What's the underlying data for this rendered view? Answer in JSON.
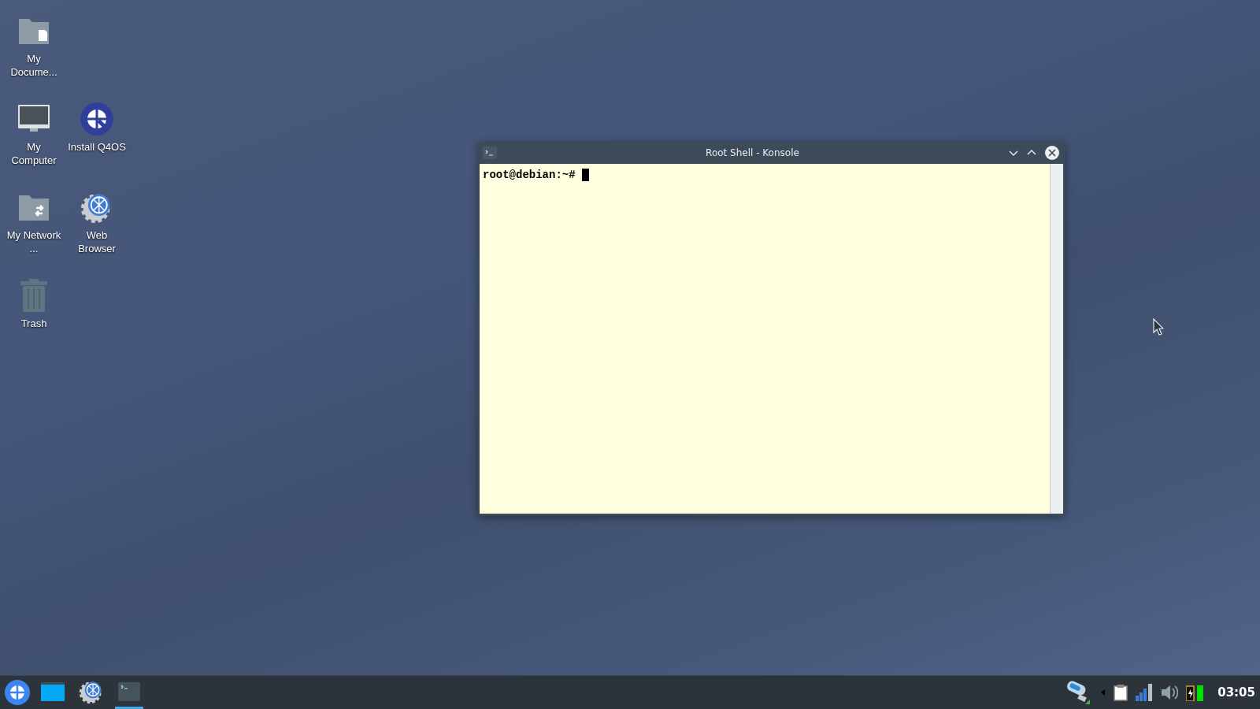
{
  "desktop_icons": [
    {
      "label": "My Docume...",
      "kind": "documents"
    },
    {
      "label": "My Computer",
      "kind": "computer"
    },
    {
      "label": "Install Q4OS",
      "kind": "installer"
    },
    {
      "label": "My Network ...",
      "kind": "network"
    },
    {
      "label": "Web Browser",
      "kind": "browser"
    },
    {
      "label": "Trash",
      "kind": "trash"
    }
  ],
  "window": {
    "title": "Root Shell - Konsole",
    "prompt": "root@debian:~#"
  },
  "taskbar": {
    "tasks": [
      {
        "kind": "files",
        "selected": false
      },
      {
        "kind": "browser",
        "selected": false
      },
      {
        "kind": "terminal",
        "selected": true
      }
    ],
    "tray": [
      {
        "kind": "usb"
      },
      {
        "kind": "expand"
      },
      {
        "kind": "clipboard"
      },
      {
        "kind": "signal"
      },
      {
        "kind": "volume"
      },
      {
        "kind": "battery"
      }
    ],
    "clock": "03:05"
  }
}
